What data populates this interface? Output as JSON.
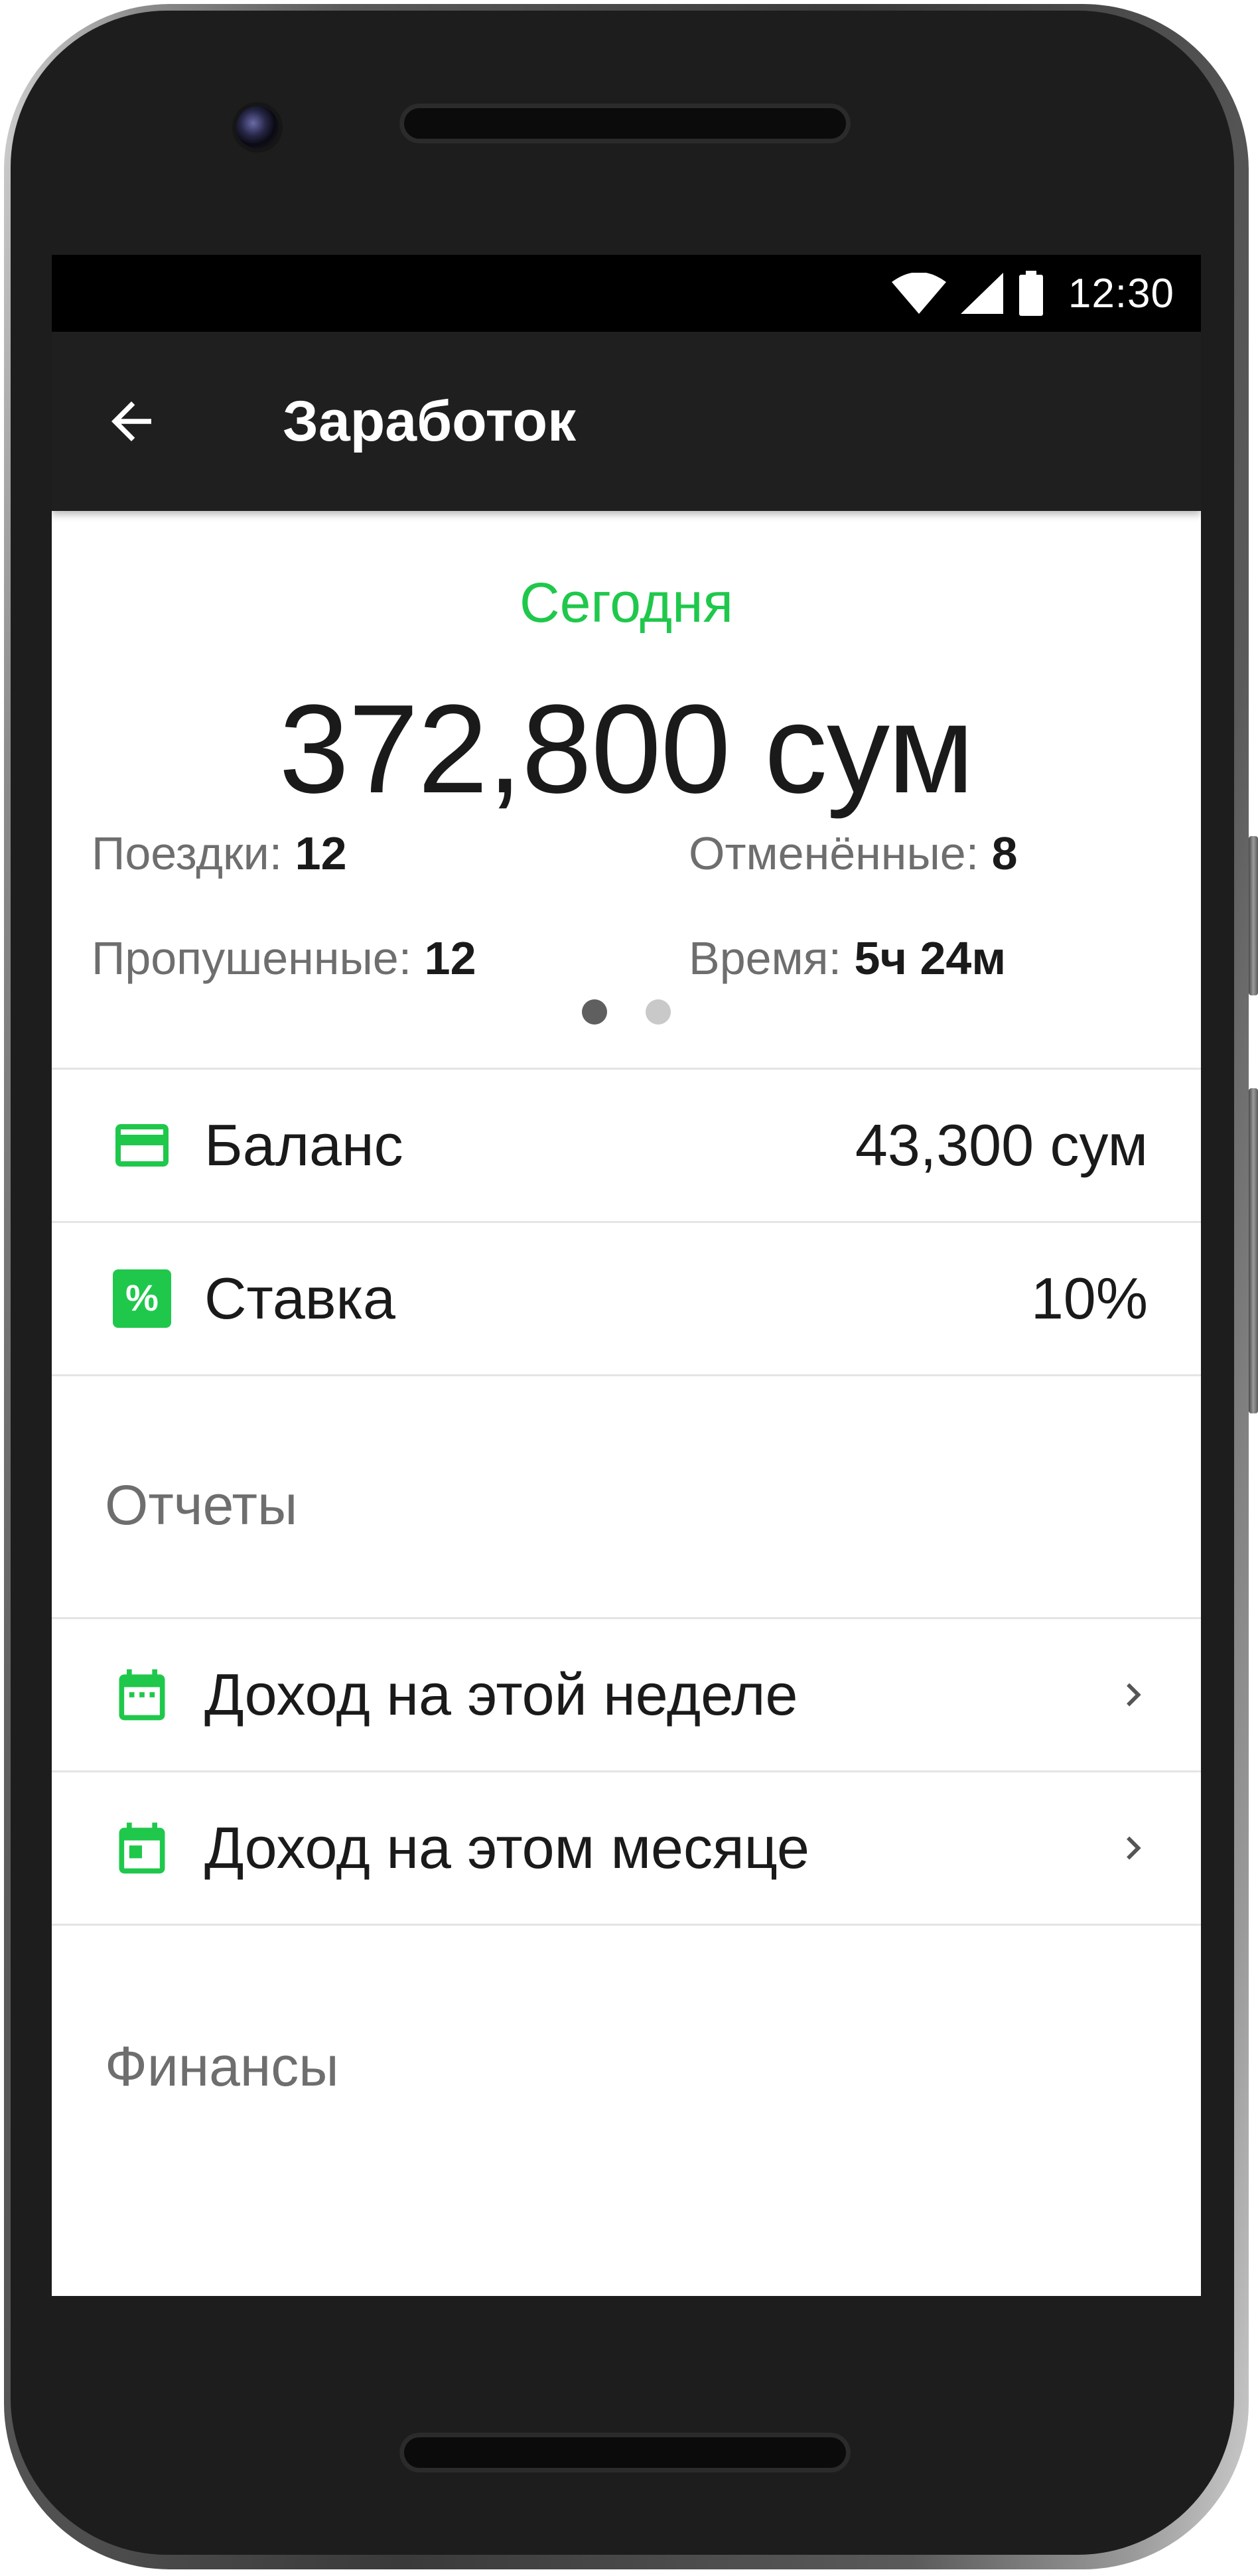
{
  "status_bar": {
    "time": "12:30",
    "icons": [
      "wifi-icon",
      "cellular-signal-icon",
      "battery-icon"
    ]
  },
  "app_bar": {
    "back_icon": "arrow-left-icon",
    "title": "Заработок"
  },
  "summary": {
    "period": "Сегодня",
    "amount": "372,800 сум",
    "stats": [
      {
        "label": "Поездки:",
        "value": "12"
      },
      {
        "label": "Отменённые:",
        "value": "8"
      },
      {
        "label": "Пропушенные:",
        "value": "12"
      },
      {
        "label": "Время:",
        "value": "5ч 24м"
      }
    ],
    "page_indicator": {
      "pages": 2,
      "active": 1
    }
  },
  "account": [
    {
      "icon": "credit-card-icon",
      "label": "Баланс",
      "value": "43,300 сум"
    },
    {
      "icon": "percent-icon",
      "label": "Ставка",
      "value": "10%"
    }
  ],
  "reports": {
    "title": "Отчеты",
    "items": [
      {
        "icon": "calendar-week-icon",
        "label": "Доход на этой неделе",
        "chevron": "chevron-right-icon"
      },
      {
        "icon": "calendar-month-icon",
        "label": "Доход на этом месяце",
        "chevron": "chevron-right-icon"
      }
    ]
  },
  "finances": {
    "title": "Финансы"
  },
  "colors": {
    "accent_green": "#1fc84b",
    "app_bar": "#1f1f1f",
    "status_bar": "#000000"
  }
}
